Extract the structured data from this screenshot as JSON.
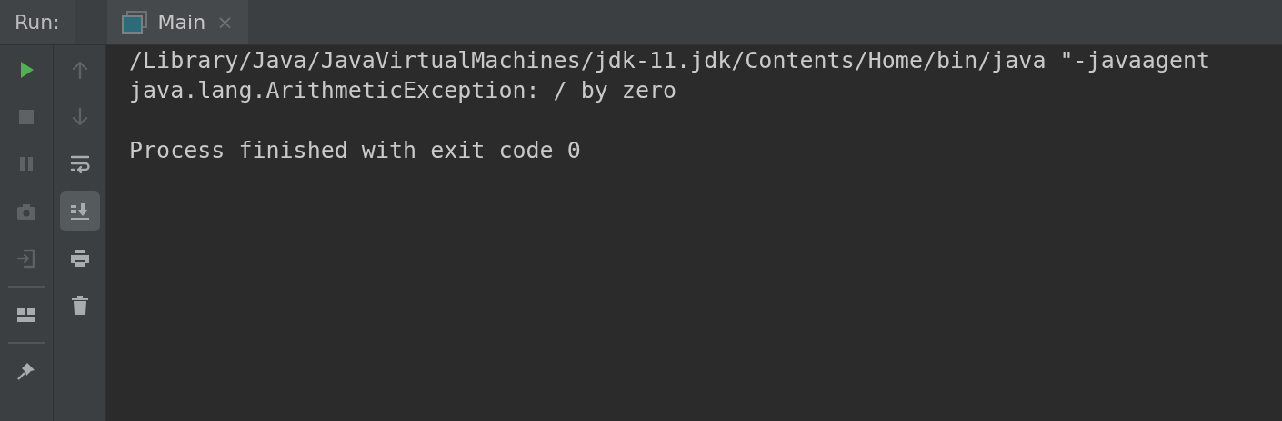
{
  "run_panel": {
    "label": "Run:",
    "tabs": [
      {
        "label": "Main",
        "close": "×",
        "selected": true
      }
    ]
  },
  "left_toolbar": [
    {
      "disabled": false
    },
    {
      "disabled": true
    },
    {
      "disabled": true
    },
    {
      "disabled": true
    },
    {
      "disabled": true
    },
    {
      "disabled": false
    },
    {
      "disabled": false
    }
  ],
  "right_toolbar": [
    {
      "disabled": true,
      "selected": false
    },
    {
      "disabled": true,
      "selected": false
    },
    {
      "disabled": false,
      "selected": false
    },
    {
      "disabled": false,
      "selected": true
    },
    {
      "disabled": false,
      "selected": false
    },
    {
      "disabled": false,
      "selected": false
    }
  ],
  "console": {
    "blocks": [
      [
        "/Library/Java/JavaVirtualMachines/jdk-11.jdk/Contents/Home/bin/java \"-javaagent",
        "java.lang.ArithmeticException: / by zero"
      ],
      [
        "Process finished with exit code 0"
      ]
    ]
  }
}
